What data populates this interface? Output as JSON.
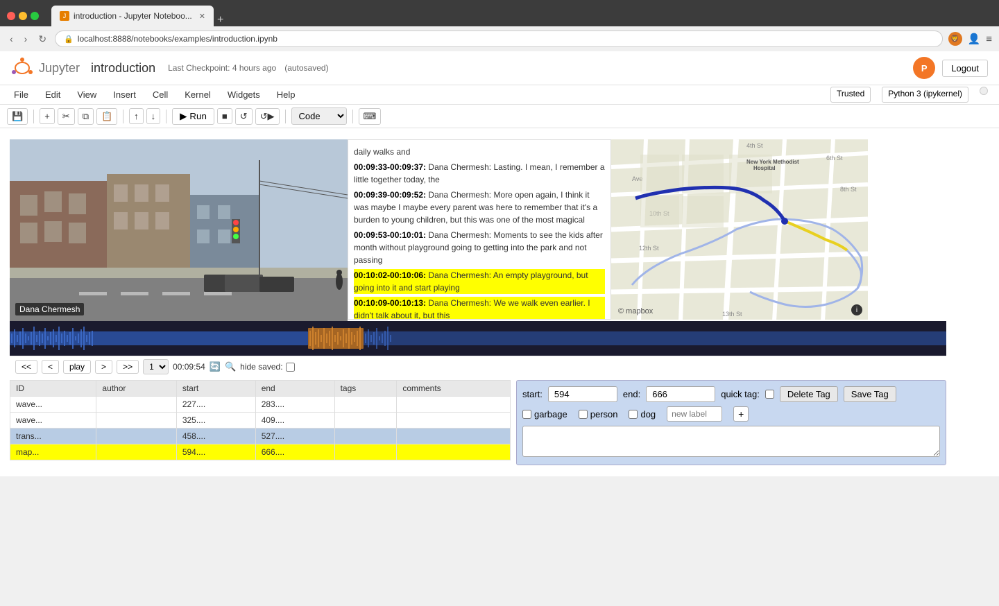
{
  "browser": {
    "tab_title": "introduction - Jupyter Noteboo...",
    "url": "localhost:8888/notebooks/examples/introduction.ipynb",
    "favicon_text": "J"
  },
  "jupyter": {
    "title": "introduction",
    "checkpoint": "Last Checkpoint: 4 hours ago",
    "autosaved": "(autosaved)",
    "logout_label": "Logout",
    "trusted_label": "Trusted",
    "kernel_label": "Python 3 (ipykernel)",
    "menu": [
      "File",
      "Edit",
      "View",
      "Insert",
      "Cell",
      "Kernel",
      "Widgets",
      "Help"
    ],
    "cell_type": "Code",
    "run_label": "Run"
  },
  "video": {
    "speaker_label": "Dana Chermesh"
  },
  "transcript": {
    "items": [
      {
        "id": 1,
        "text": "daily walks and",
        "bold_prefix": "",
        "highlighted": false
      },
      {
        "id": 2,
        "bold_prefix": "00:09:33-00:09:37:",
        "text": " Dana Chermesh: Lasting. I mean, I remember a little together today, the",
        "highlighted": false
      },
      {
        "id": 3,
        "bold_prefix": "00:09:39-00:09:52:",
        "text": " Dana Chermesh: More open again, I think it was maybe I maybe every parent was here to remember that it's a burden to young children, but this was one of the most magical",
        "highlighted": false
      },
      {
        "id": 4,
        "bold_prefix": "00:09:53-00:10:01:",
        "text": " Dana Chermesh: Moments to see the kids after month without playground going to getting into the park and not passing",
        "highlighted": false
      },
      {
        "id": 5,
        "bold_prefix": "00:10:02-00:10:06:",
        "text": " Dana Chermesh: An empty playground, but going into it and start playing",
        "highlighted": true
      },
      {
        "id": 6,
        "bold_prefix": "00:10:09-00:10:13:",
        "text": " Dana Chermesh: We we walk even earlier. I didn't talk about it, but this",
        "highlighted": true
      }
    ]
  },
  "controls": {
    "btn_first": "<<",
    "btn_prev": "<",
    "btn_play": "play",
    "btn_next": ">",
    "btn_last": ">>",
    "speed": "1",
    "time": "00:09:54",
    "hide_saved": "hide saved:"
  },
  "table": {
    "headers": [
      "ID",
      "author",
      "start",
      "end",
      "tags",
      "comments"
    ],
    "rows": [
      {
        "id": "wave...",
        "author": "",
        "start": "227....",
        "end": "283....",
        "tags": "",
        "comments": "",
        "style": "normal"
      },
      {
        "id": "wave...",
        "author": "",
        "start": "325....",
        "end": "409....",
        "tags": "",
        "comments": "",
        "style": "normal"
      },
      {
        "id": "trans...",
        "author": "",
        "start": "458....",
        "end": "527....",
        "tags": "",
        "comments": "",
        "style": "blue"
      },
      {
        "id": "map...",
        "author": "",
        "start": "594....",
        "end": "666....",
        "tags": "",
        "comments": "",
        "style": "yellow"
      }
    ]
  },
  "tag_panel": {
    "start_label": "start:",
    "start_value": "594",
    "end_label": "end:",
    "end_value": "666",
    "quick_tag_label": "quick tag:",
    "delete_tag_label": "Delete Tag",
    "save_tag_label": "Save Tag",
    "checkboxes": [
      {
        "id": "garbage",
        "label": "garbage",
        "checked": false
      },
      {
        "id": "person",
        "label": "person",
        "checked": false
      },
      {
        "id": "dog",
        "label": "dog",
        "checked": false
      }
    ],
    "new_label_placeholder": "new label",
    "add_btn": "+",
    "comments_placeholder": ""
  }
}
